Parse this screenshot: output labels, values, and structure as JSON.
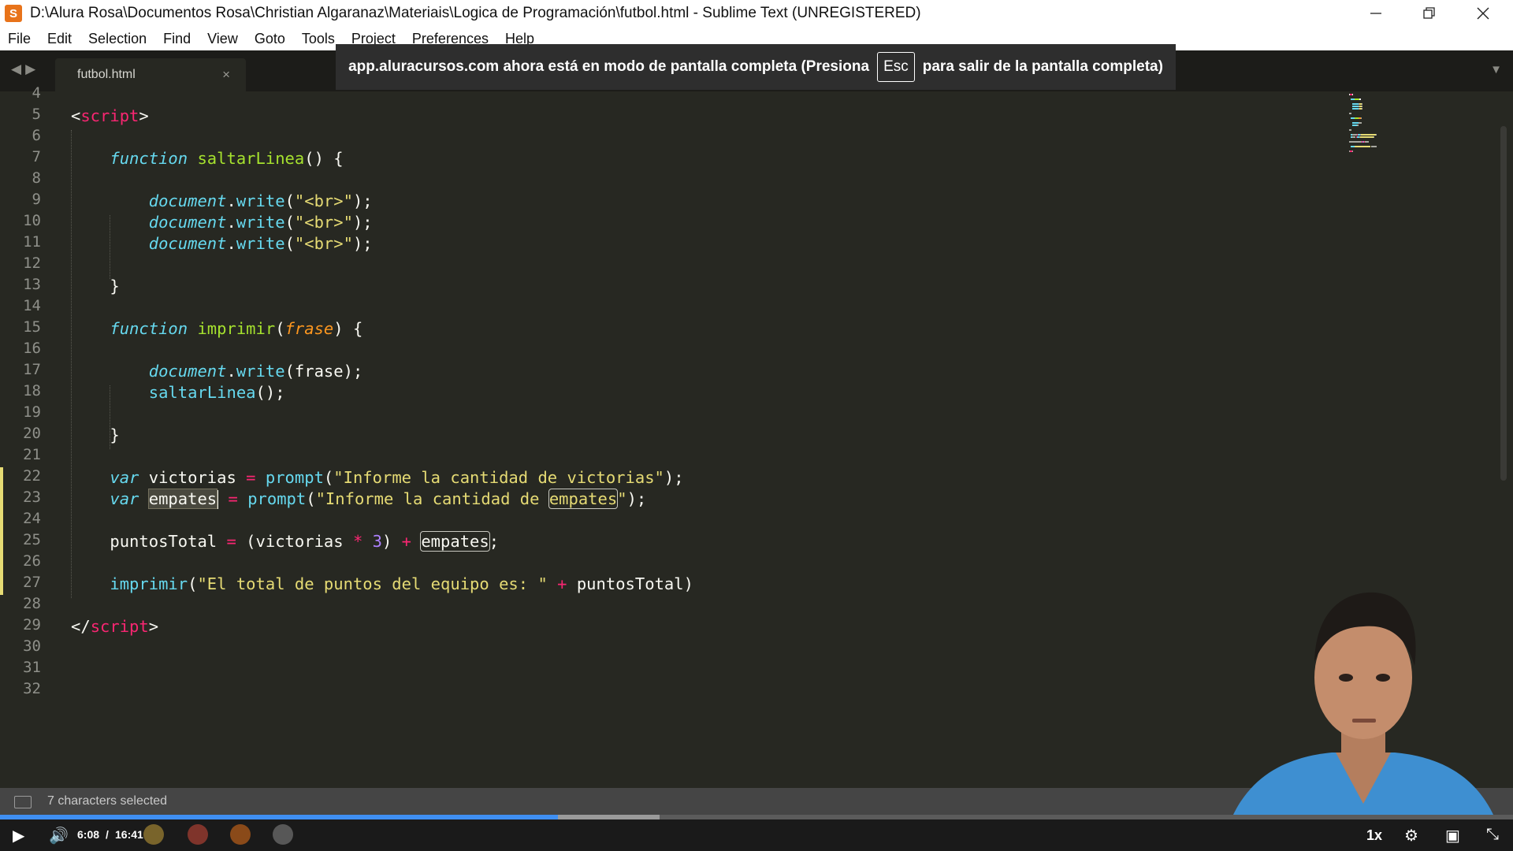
{
  "window": {
    "title": "D:\\Alura Rosa\\Documentos Rosa\\Christian Algaranaz\\Materiais\\Logica de Programación\\futbol.html - Sublime Text (UNREGISTERED)",
    "app_icon": "sublime-text-icon",
    "minimize_icon": "minimize-icon",
    "restore_icon": "restore-icon",
    "close_icon": "close-icon"
  },
  "menu": [
    "File",
    "Edit",
    "Selection",
    "Find",
    "View",
    "Goto",
    "Tools",
    "Project",
    "Preferences",
    "Help"
  ],
  "tab": {
    "label": "futbol.html",
    "close": "×"
  },
  "fullscreen_notice": {
    "before": "app.aluracursos.com ahora está en modo de pantalla completa (Presiona",
    "key": "Esc",
    "after": "para salir de la pantalla completa)"
  },
  "line_numbers": [
    "4",
    "5",
    "6",
    "7",
    "8",
    "9",
    "10",
    "11",
    "12",
    "13",
    "14",
    "15",
    "16",
    "17",
    "18",
    "19",
    "20",
    "21",
    "22",
    "23",
    "24",
    "25",
    "26",
    "27",
    "28",
    "29",
    "30",
    "31",
    "32"
  ],
  "code_lines": [
    [],
    [
      {
        "t": "<",
        "c": "#f8f8f2"
      },
      {
        "t": "script",
        "c": "#f92672"
      },
      {
        "t": ">",
        "c": "#f8f8f2"
      }
    ],
    [],
    [
      {
        "t": "    "
      },
      {
        "t": "function",
        "c": "#66d9ef",
        "i": true
      },
      {
        "t": " "
      },
      {
        "t": "saltarLinea",
        "c": "#a6e22e"
      },
      {
        "t": "() {",
        "c": "#f8f8f2"
      }
    ],
    [],
    [
      {
        "t": "        "
      },
      {
        "t": "document",
        "c": "#66d9ef",
        "i": true
      },
      {
        "t": "."
      },
      {
        "t": "write",
        "c": "#66d9ef"
      },
      {
        "t": "("
      },
      {
        "t": "\"<br>\"",
        "c": "#e6db74"
      },
      {
        "t": ");"
      }
    ],
    [
      {
        "t": "        "
      },
      {
        "t": "document",
        "c": "#66d9ef",
        "i": true
      },
      {
        "t": "."
      },
      {
        "t": "write",
        "c": "#66d9ef"
      },
      {
        "t": "("
      },
      {
        "t": "\"<br>\"",
        "c": "#e6db74"
      },
      {
        "t": ");"
      }
    ],
    [
      {
        "t": "        "
      },
      {
        "t": "document",
        "c": "#66d9ef",
        "i": true
      },
      {
        "t": "."
      },
      {
        "t": "write",
        "c": "#66d9ef"
      },
      {
        "t": "("
      },
      {
        "t": "\"<br>\"",
        "c": "#e6db74"
      },
      {
        "t": ");"
      }
    ],
    [],
    [
      {
        "t": "    }"
      }
    ],
    [],
    [
      {
        "t": "    "
      },
      {
        "t": "function",
        "c": "#66d9ef",
        "i": true
      },
      {
        "t": " "
      },
      {
        "t": "imprimir",
        "c": "#a6e22e"
      },
      {
        "t": "("
      },
      {
        "t": "frase",
        "c": "#fd971f",
        "i": true
      },
      {
        "t": ") {"
      }
    ],
    [],
    [
      {
        "t": "        "
      },
      {
        "t": "document",
        "c": "#66d9ef",
        "i": true
      },
      {
        "t": "."
      },
      {
        "t": "write",
        "c": "#66d9ef"
      },
      {
        "t": "(frase);"
      }
    ],
    [
      {
        "t": "        "
      },
      {
        "t": "saltarLinea",
        "c": "#66d9ef"
      },
      {
        "t": "();"
      }
    ],
    [],
    [
      {
        "t": "    }"
      }
    ],
    [],
    [
      {
        "t": "    "
      },
      {
        "t": "var",
        "c": "#66d9ef",
        "i": true
      },
      {
        "t": " victorias "
      },
      {
        "t": "=",
        "c": "#f92672"
      },
      {
        "t": " "
      },
      {
        "t": "prompt",
        "c": "#66d9ef"
      },
      {
        "t": "("
      },
      {
        "t": "\"Informe la cantidad de victorias\"",
        "c": "#e6db74"
      },
      {
        "t": ");"
      }
    ],
    [
      {
        "t": "    "
      },
      {
        "t": "var",
        "c": "#66d9ef",
        "i": true
      },
      {
        "t": " "
      },
      {
        "t": "empates",
        "sel": true
      },
      {
        "t": "|",
        "cursor": true
      },
      {
        "t": " "
      },
      {
        "t": "=",
        "c": "#f92672"
      },
      {
        "t": " "
      },
      {
        "t": "prompt",
        "c": "#66d9ef"
      },
      {
        "t": "("
      },
      {
        "t": "\"Informe la cantidad de ",
        "c": "#e6db74"
      },
      {
        "t": "empates",
        "c": "#e6db74",
        "box": true
      },
      {
        "t": "\"",
        "c": "#e6db74"
      },
      {
        "t": ");"
      }
    ],
    [],
    [
      {
        "t": "    puntosTotal "
      },
      {
        "t": "=",
        "c": "#f92672"
      },
      {
        "t": " (victorias "
      },
      {
        "t": "*",
        "c": "#f92672"
      },
      {
        "t": " "
      },
      {
        "t": "3",
        "c": "#ae81ff"
      },
      {
        "t": ") "
      },
      {
        "t": "+",
        "c": "#f92672"
      },
      {
        "t": " "
      },
      {
        "t": "empates",
        "box": true
      },
      {
        "t": ";"
      }
    ],
    [],
    [
      {
        "t": "    "
      },
      {
        "t": "imprimir",
        "c": "#66d9ef"
      },
      {
        "t": "("
      },
      {
        "t": "\"El total de puntos del equipo es: \"",
        "c": "#e6db74"
      },
      {
        "t": " "
      },
      {
        "t": "+",
        "c": "#f92672"
      },
      {
        "t": " puntosTotal)"
      }
    ],
    [],
    [
      {
        "t": "</"
      },
      {
        "t": "script",
        "c": "#f92672"
      },
      {
        "t": ">"
      }
    ],
    [],
    [],
    []
  ],
  "modified_lines": [
    "22",
    "23",
    "24",
    "25",
    "26",
    "27"
  ],
  "status": {
    "selection": "7 characters selected",
    "panel_icon": "monitor-icon"
  },
  "player": {
    "played_fraction": 0.369,
    "buffered_fraction": 0.436,
    "current_time": "6:08",
    "separator": "/",
    "duration": "16:41",
    "speed": "1x",
    "play_icon": "play-icon",
    "volume_icon": "volume-icon",
    "settings_icon": "gear-icon",
    "pip_icon": "picture-in-picture-icon",
    "fullscreen_icon": "exit-fullscreen-icon"
  },
  "colors": {
    "background": "#272822",
    "keyword": "#66d9ef",
    "string": "#e6db74",
    "tag": "#f92672",
    "function_name": "#a6e22e",
    "parameter": "#fd971f",
    "number": "#ae81ff",
    "progress": "#3f8ff2"
  }
}
